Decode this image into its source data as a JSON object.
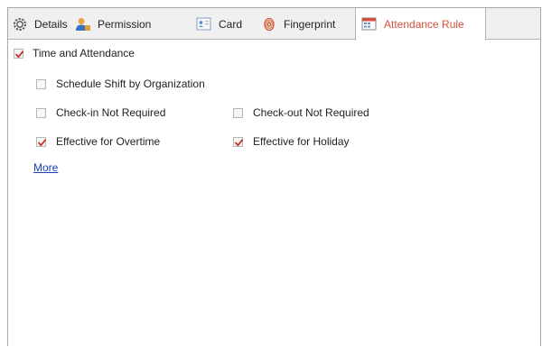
{
  "tabs": [
    {
      "label": "Details",
      "icon": "gear-icon"
    },
    {
      "label": "Permission",
      "icon": "user-key-icon"
    },
    {
      "label": "Card",
      "icon": "card-icon"
    },
    {
      "label": "Fingerprint",
      "icon": "fingerprint-icon"
    },
    {
      "label": "Attendance Rule",
      "icon": "attendance-rule-icon",
      "active": true
    }
  ],
  "attendance": {
    "main_label": "Time and Attendance",
    "main_checked": true,
    "options": {
      "schedule_shift": {
        "label": "Schedule Shift by Organization",
        "checked": false
      },
      "checkin_not_required": {
        "label": "Check-in Not Required",
        "checked": false
      },
      "checkout_not_required": {
        "label": "Check-out Not Required",
        "checked": false
      },
      "effective_overtime": {
        "label": "Effective for Overtime",
        "checked": true
      },
      "effective_holiday": {
        "label": "Effective for Holiday",
        "checked": true
      }
    },
    "more_link": "More"
  },
  "colors": {
    "active_tab_text": "#d0503c",
    "check_mark": "#c8302a",
    "link": "#1a3fb8"
  }
}
